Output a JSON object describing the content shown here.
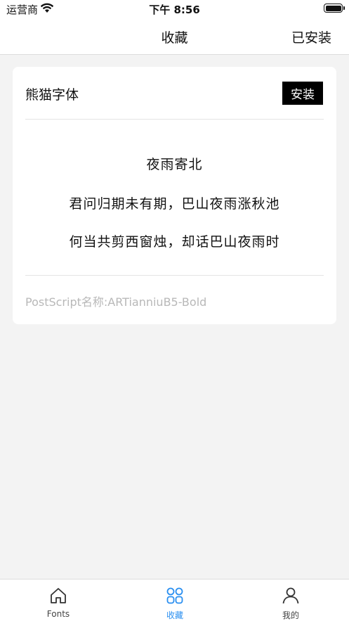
{
  "status_bar": {
    "carrier": "运营商",
    "time": "下午 8:56"
  },
  "nav": {
    "title": "收藏",
    "right_action": "已安装"
  },
  "card": {
    "font_name": "熊猫字体",
    "install_label": "安装",
    "preview_lines": [
      "夜雨寄北",
      "君问归期未有期，巴山夜雨涨秋池",
      "何当共剪西窗烛，却话巴山夜雨时"
    ],
    "postscript": "PostScript名称:ARTianniuB5-Bold"
  },
  "tabs": [
    {
      "label": "Fonts",
      "icon": "home-icon"
    },
    {
      "label": "收藏",
      "icon": "grid-icon",
      "active": true
    },
    {
      "label": "我的",
      "icon": "person-icon"
    }
  ],
  "colors": {
    "accent": "#2a8ff0",
    "background": "#f3f3f3",
    "button": "#000000"
  }
}
